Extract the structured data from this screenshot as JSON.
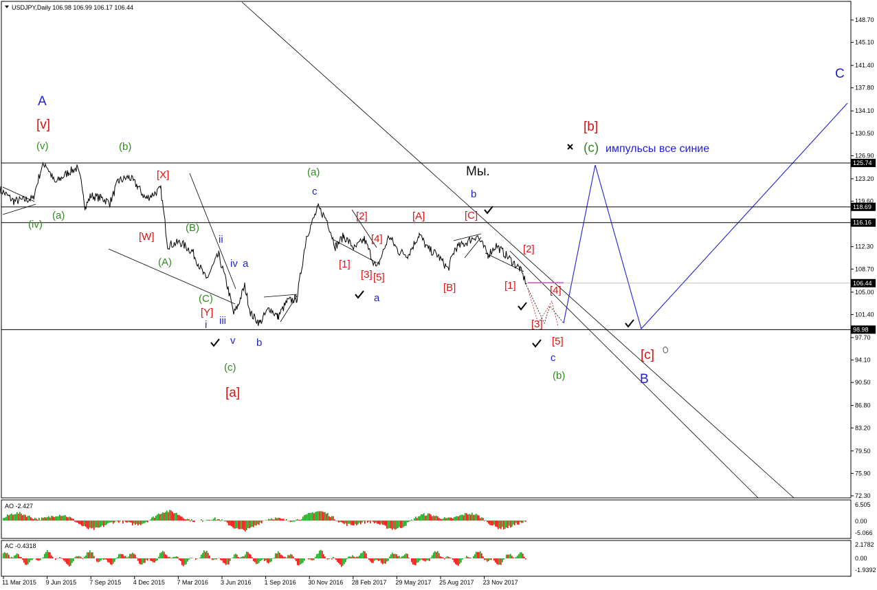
{
  "header": {
    "symbol_line": "USDJPY,Daily  106.98 106.99 106.17 106.44"
  },
  "price_axis": {
    "ticks": [
      "148.70",
      "145.10",
      "141.40",
      "137.80",
      "134.10",
      "130.50",
      "126.90",
      "123.20",
      "119.60",
      "116.00",
      "112.30",
      "108.70",
      "105.00",
      "101.40",
      "97.70",
      "94.10",
      "90.50",
      "86.80",
      "83.20",
      "79.50",
      "75.90",
      "72.30"
    ],
    "ylim": [
      72.3,
      148.7
    ]
  },
  "price_badges": [
    {
      "label": "125.74",
      "value": 125.74
    },
    {
      "label": "118.69",
      "value": 118.69
    },
    {
      "label": "116.16",
      "value": 116.16
    },
    {
      "label": "106.44",
      "value": 106.44
    },
    {
      "label": "98.98",
      "value": 98.98
    }
  ],
  "time_axis": {
    "labels": [
      "11 Mar 2015",
      "9 Jun 2015",
      "7 Sep 2015",
      "4 Dec 2015",
      "7 Mar 2016",
      "3 Jun 2016",
      "1 Sep 2016",
      "30 Nov 2016",
      "28 Feb 2017",
      "29 May 2017",
      "25 Aug 2017",
      "23 Nov 2017"
    ]
  },
  "ao_panel": {
    "title": "AO -2.427",
    "ticks": [
      "6.505",
      "0.00",
      "-5.066"
    ]
  },
  "ac_panel": {
    "title": "AC -0.4318",
    "ticks": [
      "2.1782",
      "0.00",
      "-1.9392"
    ]
  },
  "annotations": [
    {
      "text": "A",
      "color": "#1f1fd6"
    },
    {
      "text": "[v]",
      "color": "#e01010"
    },
    {
      "text": "(v)",
      "color": "#2e8b1e"
    },
    {
      "text": "(b)",
      "color": "#2e8b1e"
    },
    {
      "text": "(iv)",
      "color": "#2e8b1e"
    },
    {
      "text": "(a)",
      "color": "#2e8b1e"
    },
    {
      "text": "[X]",
      "color": "#e01010"
    },
    {
      "text": "[W]",
      "color": "#e01010"
    },
    {
      "text": "(B)",
      "color": "#2e8b1e"
    },
    {
      "text": "(A)",
      "color": "#2e8b1e"
    },
    {
      "text": "ii",
      "color": "#1f1fd6"
    },
    {
      "text": "iv",
      "color": "#1f1fd6"
    },
    {
      "text": "a",
      "color": "#1f1fd6"
    },
    {
      "text": "(C)",
      "color": "#2e8b1e"
    },
    {
      "text": "[Y]",
      "color": "#e01010"
    },
    {
      "text": "i",
      "color": "#1f1fd6"
    },
    {
      "text": "iii",
      "color": "#1f1fd6"
    },
    {
      "text": "v",
      "color": "#1f1fd6"
    },
    {
      "text": "b",
      "color": "#1f1fd6"
    },
    {
      "text": "(c)",
      "color": "#2e8b1e"
    },
    {
      "text": "[a]",
      "color": "#e01010"
    },
    {
      "text": "(a)",
      "color": "#2e8b1e"
    },
    {
      "text": "c",
      "color": "#1f1fd6"
    },
    {
      "text": "[2]",
      "color": "#e01010"
    },
    {
      "text": "[4]",
      "color": "#e01010"
    },
    {
      "text": "[1]",
      "color": "#e01010"
    },
    {
      "text": "[3]",
      "color": "#e01010"
    },
    {
      "text": "[5]",
      "color": "#e01010"
    },
    {
      "text": "a",
      "color": "#1f1fd6"
    },
    {
      "text": "[A]",
      "color": "#e01010"
    },
    {
      "text": "[B]",
      "color": "#e01010"
    },
    {
      "text": "[C]",
      "color": "#e01010"
    },
    {
      "text": "Мы.",
      "color": "#111111"
    },
    {
      "text": "b",
      "color": "#1f1fd6"
    },
    {
      "text": "[2]",
      "color": "#e01010"
    },
    {
      "text": "[1]",
      "color": "#e01010"
    },
    {
      "text": "[4]",
      "color": "#e01010"
    },
    {
      "text": "[3]",
      "color": "#e01010"
    },
    {
      "text": "[5]",
      "color": "#e01010"
    },
    {
      "text": "c",
      "color": "#1f1fd6"
    },
    {
      "text": "(b)",
      "color": "#2e8b1e"
    },
    {
      "text": "[b]",
      "color": "#e01010"
    },
    {
      "text": "(c)",
      "color": "#2e8b1e"
    },
    {
      "text": "импульсы все синие",
      "color": "#1f1fd6"
    },
    {
      "text": "[c]",
      "color": "#e01010"
    },
    {
      "text": "B",
      "color": "#1f1fd6"
    },
    {
      "text": "C",
      "color": "#1f1fd6"
    }
  ],
  "colors": {
    "background": "#ffffff",
    "price_line": "#000000",
    "projection": "#1f1fd6",
    "up_bar": "#1a9a1a",
    "down_bar": "#e01010",
    "level_line": "#000000",
    "magenta_line": "#cc33cc"
  }
}
